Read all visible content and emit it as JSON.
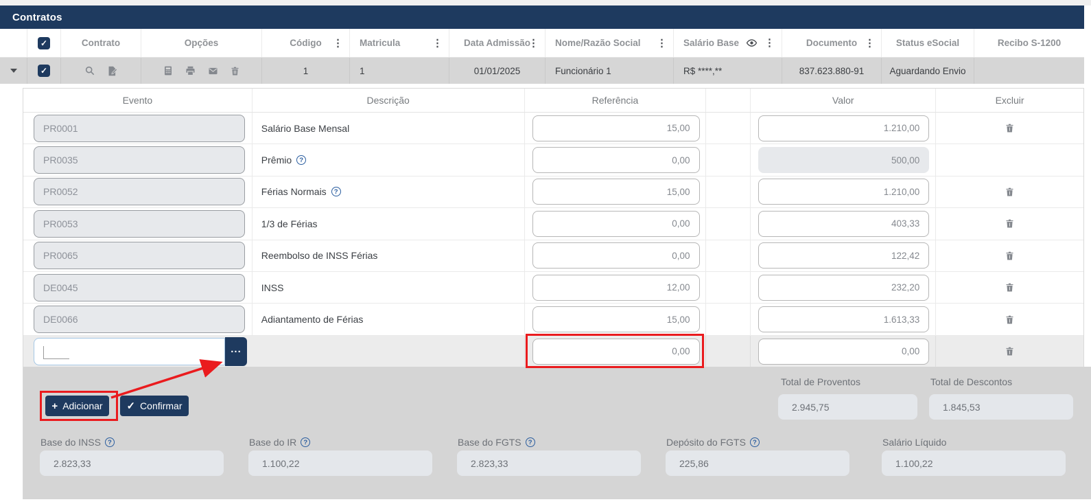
{
  "colors": {
    "accent_navy": "#1e3a5f",
    "annotation_red": "#ea1b1e",
    "help_blue": "#2a5d9f",
    "selected_row_gray": "#d6d6d6",
    "panel_gray": "#d5d5d5"
  },
  "title_bar": {
    "title": "Contratos"
  },
  "grid": {
    "columns": [
      {
        "label": "Contrato"
      },
      {
        "label": "Opções"
      },
      {
        "label": "Código"
      },
      {
        "label": "Matricula"
      },
      {
        "label": "Data Admissão"
      },
      {
        "label": "Nome/Razão Social"
      },
      {
        "label": "Salário Base"
      },
      {
        "label": "Documento"
      },
      {
        "label": "Status eSocial"
      },
      {
        "label": "Recibo S-1200"
      }
    ],
    "row": {
      "codigo": "1",
      "matricula": "1",
      "data_admissao": "01/01/2025",
      "nome": "Funcionário 1",
      "salario_base": "R$ ****,**",
      "documento": "837.623.880-91",
      "status_esocial": "Aguardando Envio",
      "recibo": ""
    }
  },
  "detail": {
    "header": {
      "evento": "Evento",
      "descricao": "Descrição",
      "referencia": "Referência",
      "valor": "Valor",
      "excluir": "Excluir"
    },
    "rows": [
      {
        "code": "PR0001",
        "desc": "Salário Base Mensal",
        "ref": "15,00",
        "val": "1.210,00"
      },
      {
        "code": "PR0035",
        "desc": "Prêmio",
        "ref": "0,00",
        "val": "500,00"
      },
      {
        "code": "PR0052",
        "desc": "Férias Normais",
        "ref": "15,00",
        "val": "1.210,00"
      },
      {
        "code": "PR0053",
        "desc": "1/3 de Férias",
        "ref": "0,00",
        "val": "403,33"
      },
      {
        "code": "PR0065",
        "desc": "Reembolso de INSS Férias",
        "ref": "0,00",
        "val": "122,42"
      },
      {
        "code": "DE0045",
        "desc": "INSS",
        "ref": "12,00",
        "val": "232,20"
      },
      {
        "code": "DE0066",
        "desc": "Adiantamento de Férias",
        "ref": "15,00",
        "val": "1.613,33"
      }
    ],
    "new_row": {
      "code": "",
      "menu": "...",
      "ref": "0,00",
      "val": "0,00"
    }
  },
  "footer": {
    "add_label": "Adicionar",
    "confirm_label": "Confirmar",
    "totals": [
      {
        "label": "Total de Proventos",
        "value": "2.945,75"
      },
      {
        "label": "Total de Descontos",
        "value": "1.845,53"
      }
    ],
    "bases": [
      {
        "label": "Base do INSS",
        "value": "2.823,33"
      },
      {
        "label": "Base do IR",
        "value": "1.100,22"
      },
      {
        "label": "Base do FGTS",
        "value": "2.823,33"
      },
      {
        "label": "Depósito do FGTS",
        "value": "225,86"
      },
      {
        "label": "Salário Líquido",
        "value": "1.100,22"
      }
    ]
  },
  "icons": {
    "search-icon": "magnifier",
    "edit-contract-icon": "document-pencil",
    "calculator-icon": "calculator",
    "print-icon": "printer",
    "mail-icon": "envelope",
    "delete-icon": "trash",
    "eye-icon": "visibility",
    "column-menu-icon": "kebab-vertical",
    "expand-caret-icon": "caret-down",
    "checkbox-check": "✓",
    "plus-icon": "+",
    "check-icon": "✓",
    "help-icon": "?"
  }
}
